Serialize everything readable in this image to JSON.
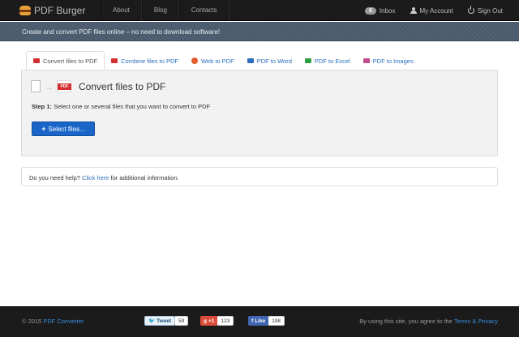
{
  "nav": {
    "brand": "PDF Burger",
    "links": [
      "About",
      "Blog",
      "Contacts"
    ],
    "inbox_count": "0",
    "inbox_label": "Inbox",
    "account_label": "My Account",
    "signout_label": "Sign Out"
  },
  "subheader": {
    "text": "Create and convert PDF files online – no need to download software!"
  },
  "tabs": [
    {
      "label": "Convert files to PDF",
      "icon": "pdf-icon",
      "color": "#d32f2f"
    },
    {
      "label": "Combine files to PDF",
      "icon": "combine-icon",
      "color": "#d32f2f"
    },
    {
      "label": "Web to PDF",
      "icon": "globe-icon",
      "color": "#e35b2d"
    },
    {
      "label": "PDF to Word",
      "icon": "word-icon",
      "color": "#2a6ebb"
    },
    {
      "label": "PDF to Excel",
      "icon": "excel-icon",
      "color": "#2e9e3e"
    },
    {
      "label": "PDF to Images",
      "icon": "image-icon",
      "color": "#c24b8e"
    }
  ],
  "panel": {
    "title": "Convert files to PDF",
    "step_label": "Step 1:",
    "step_text": "Select one or several files that you want to convert to PDF",
    "select_button": "Select files...",
    "pdf_badge": "PDF"
  },
  "help": {
    "prefix": "Do you need help?",
    "link": "Click here",
    "suffix": "for additional information."
  },
  "footer": {
    "copyright": "© 2015",
    "converter_link": "PDF Converter",
    "tweet_label": "Tweet",
    "tweet_count": "59",
    "gplus_label": "+1",
    "gplus_count": "123",
    "like_label": "Like",
    "like_count": "198",
    "terms_prefix": "By using this site, you agree to the",
    "terms_link": "Terms & Privacy"
  },
  "colors": {
    "navbar": "#1b1b1b",
    "subheader": "#4a5a6d",
    "link": "#2a6ebb",
    "primary_button": "#1a66c8"
  }
}
